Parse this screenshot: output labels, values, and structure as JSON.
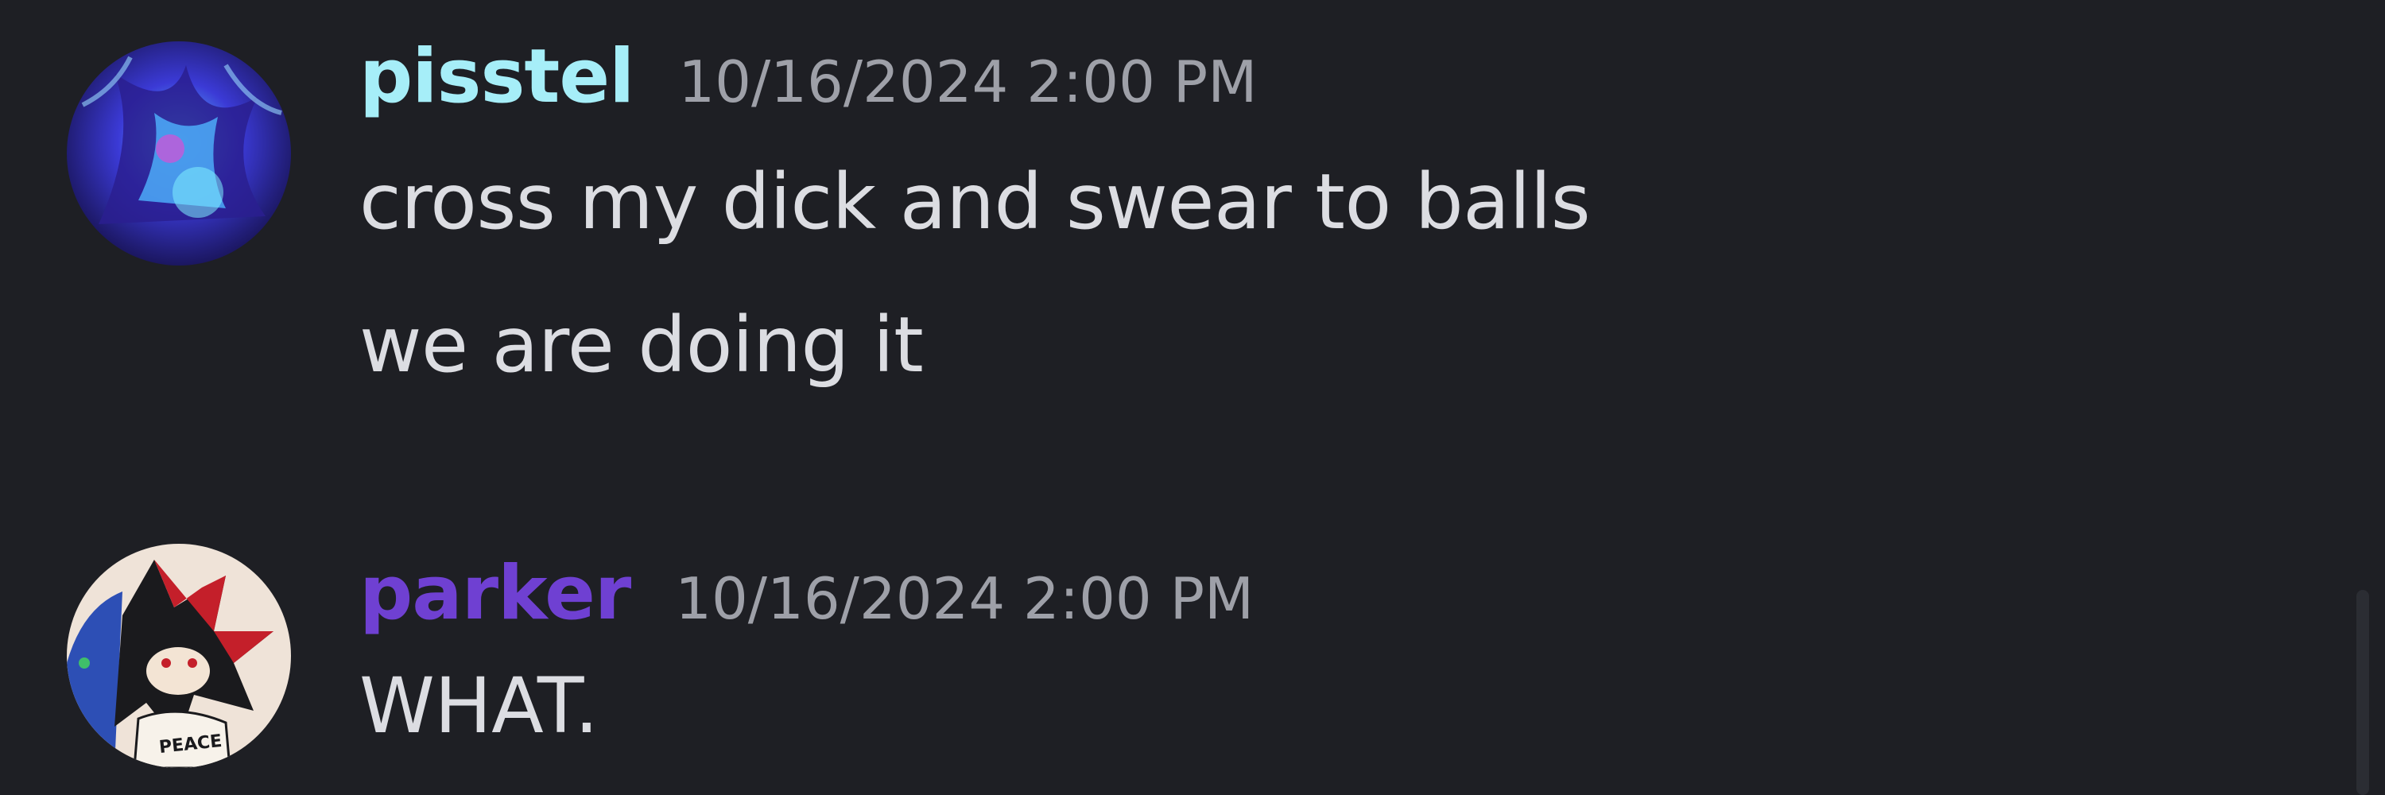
{
  "messages": [
    {
      "username": "pisstel",
      "username_color": "#a6eef8",
      "timestamp": "10/16/2024 2:00 PM",
      "avatar": "avatar-icon",
      "lines": [
        "cross my dick and swear to balls",
        "we are doing it"
      ]
    },
    {
      "username": "parker",
      "username_color": "#6f40d2",
      "timestamp": "10/16/2024 2:00 PM",
      "avatar": "avatar-icon",
      "avatar_text": "PEACE",
      "lines": [
        "WHAT."
      ]
    }
  ],
  "colors": {
    "background": "#1e1f24",
    "message_text": "#dcdde2",
    "timestamp": "#9ea0a8",
    "scrollbar": "#2b2d33"
  }
}
